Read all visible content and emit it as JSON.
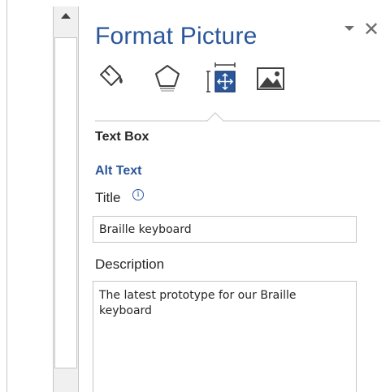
{
  "pane": {
    "title": "Format Picture",
    "options_icon": "chevron-down-icon",
    "close_icon": "close-icon",
    "close_glyph": "✕"
  },
  "tabs": [
    {
      "name": "fill-line",
      "icon": "paint-bucket-icon",
      "selected": false
    },
    {
      "name": "effects",
      "icon": "pentagon-icon",
      "selected": false
    },
    {
      "name": "size-properties",
      "icon": "size-position-icon",
      "selected": true
    },
    {
      "name": "picture",
      "icon": "picture-icon",
      "selected": false
    }
  ],
  "section": {
    "text_box": "Text Box",
    "alt_text": "Alt Text"
  },
  "fields": {
    "title_label": "Title",
    "title_value": "Braille keyboard",
    "info_glyph": "i",
    "description_label": "Description",
    "description_value": "The latest prototype for our Braille keyboard"
  },
  "colors": {
    "accent": "#2b579a",
    "text": "#262626",
    "border": "#c6c6c6"
  }
}
